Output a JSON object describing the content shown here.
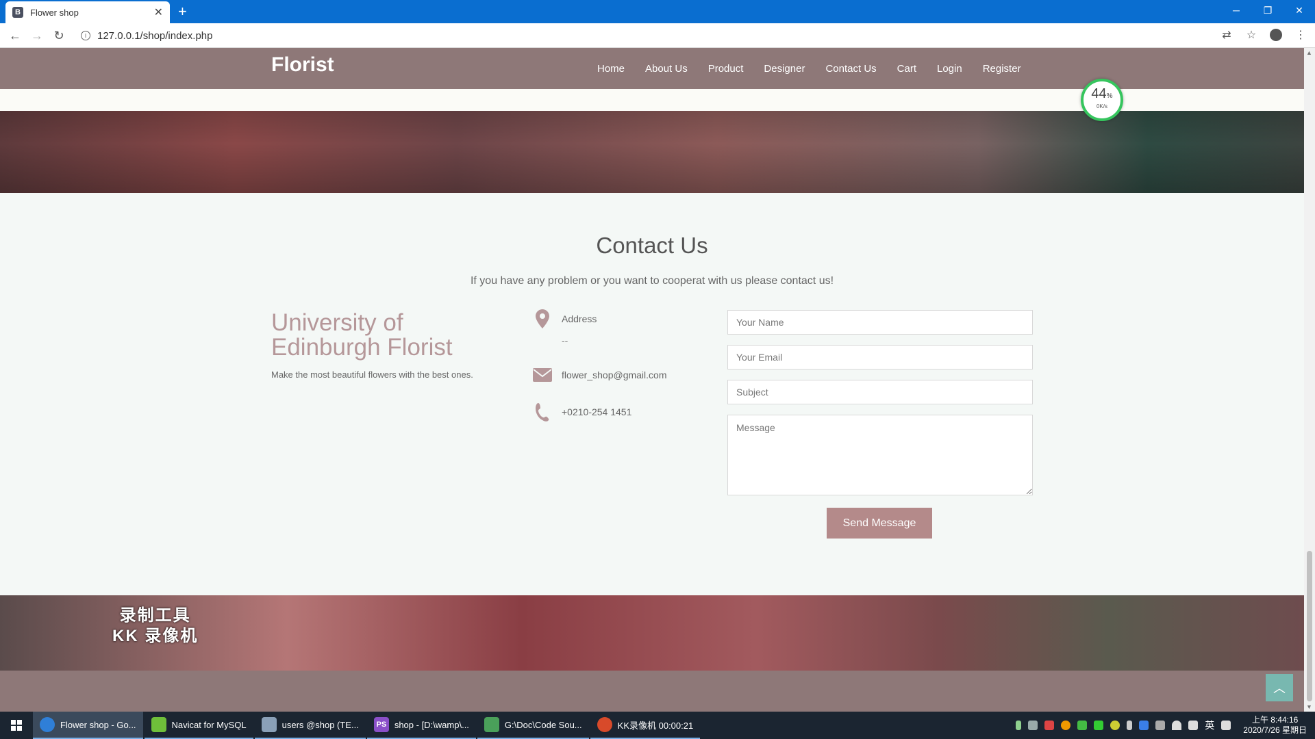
{
  "browser": {
    "tab_title": "Flower shop",
    "favicon_letter": "B",
    "url": "127.0.0.1/shop/index.php"
  },
  "site": {
    "brand": "Florist",
    "menu": [
      "Home",
      "About Us",
      "Product",
      "Designer",
      "Contact Us",
      "Cart",
      "Login",
      "Register"
    ]
  },
  "speed_widget": {
    "percent": "44",
    "percent_sign": "%",
    "speed": "0K/s"
  },
  "contact": {
    "title": "Contact Us",
    "subtitle": "If you have any problem or you want to cooperat with us please contact us!",
    "org_name": "University of Edinburgh Florist",
    "tagline": "Make the most beautiful flowers with the best ones.",
    "address_label": "Address",
    "address_value": "--",
    "email": "flower_shop@gmail.com",
    "phone": "+0210-254 1451"
  },
  "form": {
    "name_placeholder": "Your Name",
    "email_placeholder": "Your Email",
    "subject_placeholder": "Subject",
    "message_placeholder": "Message",
    "send_label": "Send Message"
  },
  "watermark": {
    "line1": "录制工具",
    "line2": "KK 录像机"
  },
  "taskbar": {
    "items": [
      {
        "label": "Flower shop - Go...",
        "color": "#2f7fd8",
        "active": true
      },
      {
        "label": "Navicat for MySQL",
        "color": "#6fbf3a"
      },
      {
        "label": "users @shop (TE...",
        "color": "#8aa0b8"
      },
      {
        "label": "shop - [D:\\wamp\\...",
        "color": "#8a4fc8",
        "ico": "PS"
      },
      {
        "label": "G:\\Doc\\Code Sou...",
        "color": "#4aa05a"
      },
      {
        "label": "KK录像机 00:00:21",
        "color": "#d84a2a"
      }
    ],
    "ime": "英",
    "time": "上午 8:44:16",
    "date": "2020/7/26 星期日"
  },
  "colors": {
    "navbar": "#8e7878",
    "accent": "#b48a8a",
    "gauge_ring": "#36c55e",
    "back_to_top": "#78b8b0"
  }
}
